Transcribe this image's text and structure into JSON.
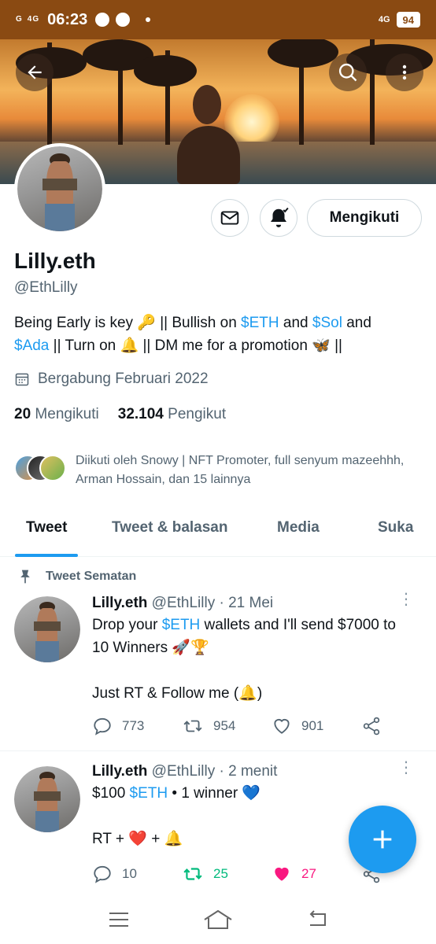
{
  "status_bar": {
    "signal1": "G",
    "signal2": "4G",
    "time": "06:23",
    "network": "4G",
    "battery": "94"
  },
  "profile": {
    "name": "Lilly.eth",
    "handle": "@EthLilly",
    "follow_label": "Mengikuti",
    "bio": {
      "p1": "Being Early is key 🔑 || Bullish on ",
      "tag1": "$ETH",
      "p2": " and ",
      "tag2": "$Sol",
      "p3": " and ",
      "tag3": "$Ada",
      "p4": " || Turn on 🔔 || DM me for a promotion 🦋 ||"
    },
    "joined": "Bergabung Februari 2022",
    "following_count": "20",
    "following_label": "Mengikuti",
    "followers_count": "32.104",
    "followers_label": "Pengikut",
    "followed_by": "Diikuti oleh Snowy | NFT Promoter, full senyum mazeehhh, Arman Hossain, dan 15 lainnya"
  },
  "tabs": [
    {
      "label": "Tweet",
      "active": true
    },
    {
      "label": "Tweet & balasan",
      "active": false
    },
    {
      "label": "Media",
      "active": false
    },
    {
      "label": "Suka",
      "active": false
    }
  ],
  "pinned_label": "Tweet Sematan",
  "tweets": [
    {
      "name": "Lilly.eth",
      "meta": "@EthLilly · 21 Mei",
      "text_a": "Drop your ",
      "tag": "$ETH",
      "text_b": " wallets and I'll send $7000 to 10 Winners 🚀🏆",
      "text_c": "Just RT & Follow me (🔔)",
      "replies": "773",
      "retweets": "954",
      "likes": "901"
    },
    {
      "name": "Lilly.eth",
      "meta": "@EthLilly · 2 menit",
      "text_a": "$100 ",
      "tag": "$ETH",
      "text_b": " • 1 winner 💙",
      "text_c": "RT + ❤️ + 🔔",
      "replies": "10",
      "retweets": "25",
      "likes": "27"
    }
  ],
  "colors": {
    "accent": "#1d9bf0",
    "retweet_active": "#00ba7c",
    "like_active": "#f91880",
    "status_bar": "#8a4a12"
  },
  "icons": [
    "back-arrow-icon",
    "search-icon",
    "more-vertical-icon",
    "mail-icon",
    "bell-icon",
    "calendar-icon",
    "pin-icon",
    "reply-icon",
    "retweet-icon",
    "heart-icon",
    "share-icon",
    "compose-icon",
    "menu-icon",
    "home-icon",
    "back-icon"
  ]
}
